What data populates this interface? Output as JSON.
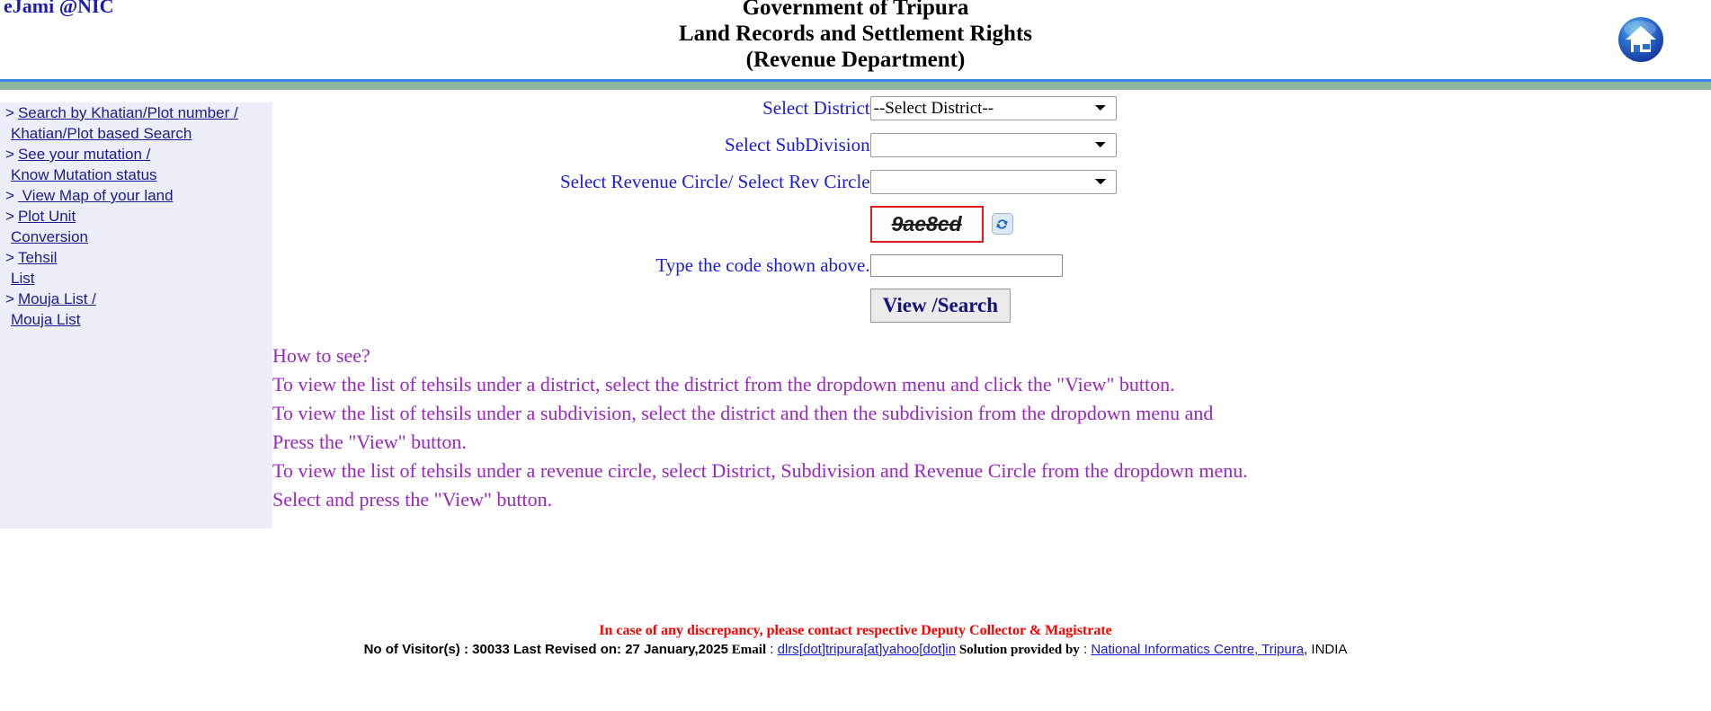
{
  "header": {
    "brand": "eJami @NIC",
    "title_line1": "Government of Tripura",
    "title_line2": "Land Records and Settlement Rights",
    "title_line3": "(Revenue Department)",
    "home_icon": "home-icon",
    "divider_blue": "#3d85f0",
    "divider_green": "#8fb59c"
  },
  "sidebar": {
    "background": "#eeeefb",
    "link_color": "#1b1b8f",
    "items": [
      {
        "arrow": ">",
        "line1": "Search by Khatian/Plot number /",
        "line2": "Khatian/Plot based Search"
      },
      {
        "arrow": ">",
        "line1": "See your mutation /",
        "line2": "Know Mutation status"
      },
      {
        "arrow": ">",
        "line1": "   View Map of your land",
        "line2": ""
      },
      {
        "arrow": ">",
        "line1": "Plot Unit",
        "line2": "Conversion"
      },
      {
        "arrow": ">",
        "line1": "Tehsil",
        "line2": "List"
      },
      {
        "arrow": ">",
        "line1": "Mouja List /",
        "line2": "Mouja List"
      }
    ]
  },
  "form": {
    "label_color": "#1a1ae0",
    "district": {
      "label": "Select District",
      "selected": "--Select District--",
      "options": [
        "--Select District--"
      ]
    },
    "subdivision": {
      "label": "Select SubDivision",
      "selected": "",
      "options": [
        ""
      ]
    },
    "revcircle": {
      "label": "Select Revenue Circle/ Select Rev Circle",
      "selected": "",
      "options": [
        ""
      ]
    },
    "captcha": {
      "code": "9ae8cd",
      "border_color": "#e01b1b",
      "refresh_icon": "refresh-icon"
    },
    "code_input": {
      "label": "Type the code shown above.",
      "value": "",
      "placeholder": ""
    },
    "submit_label": "View /Search"
  },
  "instructions": {
    "color": "#9b26c4",
    "lines": [
      "How to see?",
      "To view the list of tehsils under a district, select the district from the dropdown menu and click the \"View\" button.",
      "To view the list of tehsils under a subdivision, select the district and then the subdivision from the dropdown menu and",
      "Press the \"View\" button.",
      "To view the list of tehsils under a revenue circle, select District, Subdivision and Revenue Circle from the dropdown menu.",
      "Select and press the \"View\" button."
    ]
  },
  "footer": {
    "discrepancy": "In case of any discrepancy, please contact respective Deputy Collector & Magistrate",
    "visitors": "No of Visitor(s) : 30033 Last Revised on: 27 January,2025",
    "email_label": "Email",
    "email_sep": ":",
    "email_link": "dlrs[dot]tripura[at]yahoo[dot]in",
    "solution_label": "Solution provided by",
    "solution_sep": ":",
    "solution_link": "National Informatics Centre, Tripura",
    "country": ", INDIA"
  }
}
